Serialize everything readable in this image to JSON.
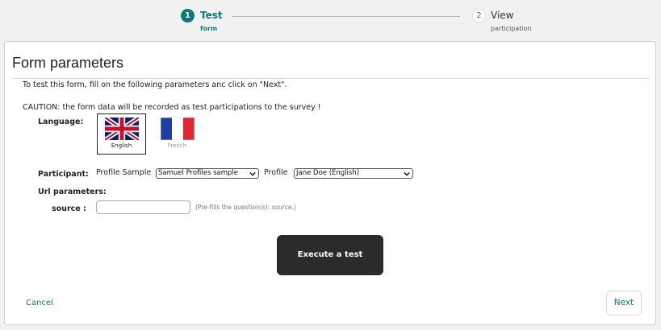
{
  "stepper": {
    "step1": {
      "number": "1",
      "title": "Test",
      "subtitle": "form"
    },
    "step2": {
      "number": "2",
      "title": "View",
      "subtitle": "participation"
    }
  },
  "panel": {
    "title": "Form parameters",
    "intro": "To test this form, fill on the following parameters anc click on \"Next\".",
    "caution": "CAUTION: the form data will be recorded as test participations to the survey !"
  },
  "language": {
    "label": "Language:",
    "options": [
      {
        "name": "English",
        "icon": "uk-flag-icon",
        "selected": true
      },
      {
        "name": "French",
        "icon": "france-flag-icon",
        "selected": false
      }
    ]
  },
  "participant": {
    "label": "Participant:",
    "profile_sample_label": "Profile Sample",
    "profile_sample_value": "Samuel Profiles sample",
    "profile_label": "Profile",
    "profile_value": "Jane Doe (English)"
  },
  "url_parameters": {
    "label": "Url parameters:",
    "source_label": "source :",
    "source_value": "",
    "prefill_prefix": "(Pre-fills the question(s): ",
    "prefill_question": "source.",
    "prefill_suffix": ")"
  },
  "actions": {
    "execute": "Execute a test",
    "cancel": "Cancel",
    "next": "Next"
  },
  "colors": {
    "accent": "#0d7a78",
    "execute_bg": "#2b2b2b"
  }
}
